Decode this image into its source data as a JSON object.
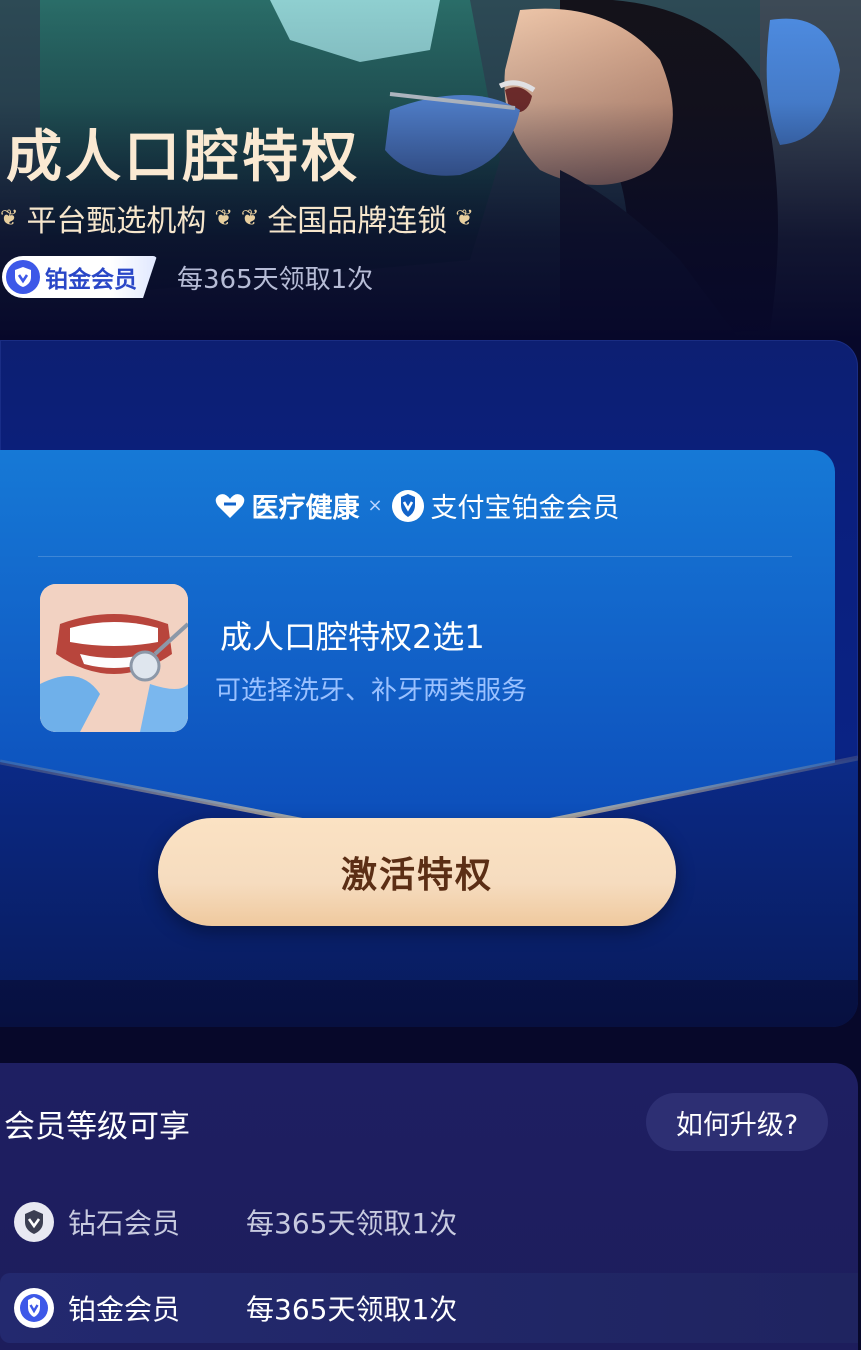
{
  "hero": {
    "title": "成人口腔特权",
    "tags": [
      "平台甄选机构",
      "全国品牌连锁"
    ],
    "member_tier": "铂金会员",
    "frequency": "每365天领取1次"
  },
  "card": {
    "brand_left": "医疗健康",
    "brand_sep": "×",
    "brand_right": "支付宝铂金会员",
    "item_title": "成人口腔特权2选1",
    "item_desc": "可选择洗牙、补牙两类服务",
    "cta_label": "激活特权"
  },
  "tiers": {
    "title": "会员等级可享",
    "upgrade_label": "如何升级?",
    "items": [
      {
        "name": "钻石会员",
        "note": "每365天领取1次",
        "icon": "diamond-badge-icon",
        "active": false
      },
      {
        "name": "铂金会员",
        "note": "每365天领取1次",
        "icon": "platinum-badge-icon",
        "active": true
      }
    ]
  },
  "colors": {
    "title_gold": "#fae9d2",
    "cta_bg": "#f6dcbf",
    "cta_text": "#5b2e15",
    "platinum_blue": "#3d58e8",
    "card_blue": "#1263c9"
  }
}
